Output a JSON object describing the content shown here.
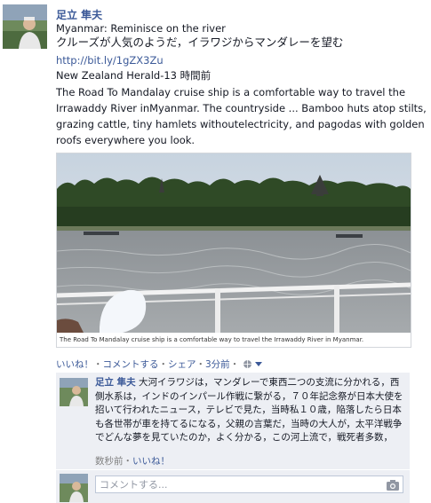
{
  "post": {
    "author": "足立 隼夫",
    "link_title": "Myanmar: Reminisce on the river",
    "japanese_text": "クルーズが人気のようだ，イラワジからマンダレーを望む",
    "short_url": "http://bit.ly/1gZX3Zu",
    "source_time": "New Zealand Herald-13 時間前",
    "description": "The Road To Mandalay cruise ship is a comfortable way to travel the Irrawaddy River inMyanmar. The countryside ... Bamboo huts atop stilts, grazing cattle, tiny hamlets withoutelectricity, and pagodas with golden roofs everywhere you look.",
    "photo_caption": "The Road To Mandalay cruise ship is a comfortable way to travel the Irrawaddy River in Myanmar."
  },
  "actions": {
    "like": "いいね！",
    "sep1": "・",
    "comment": "コメントする",
    "sep2": "・",
    "share": "シェア",
    "sep3": "・",
    "time": "3分前",
    "sep4": "・"
  },
  "comment": {
    "author": "足立 隼夫",
    "text": "大河イラワジは，マンダレーで東西二つの支流に分かれる，西側水系は，インドのインパール作戦に繋がる，７０年記念祭が日本大使を招いて行われたニュース，テレビで見た，当時私１０歳，陥落したら日本も各世帯が車を持てるになる，父親の言葉だ，当時の大人が，太平洋戦争でどんな夢を見ていたのか，よく分かる，この河上流で，戦死者多数，",
    "time": "数秒前",
    "sep": "・",
    "like": "いいね！"
  },
  "reply": {
    "placeholder": "コメントする..."
  },
  "icons": {
    "privacy": "globe-icon",
    "dropdown": "chevron-down-icon",
    "camera": "camera-icon"
  },
  "colors": {
    "link": "#3b5998",
    "comment_bg": "#edeff4",
    "meta": "#808080"
  }
}
